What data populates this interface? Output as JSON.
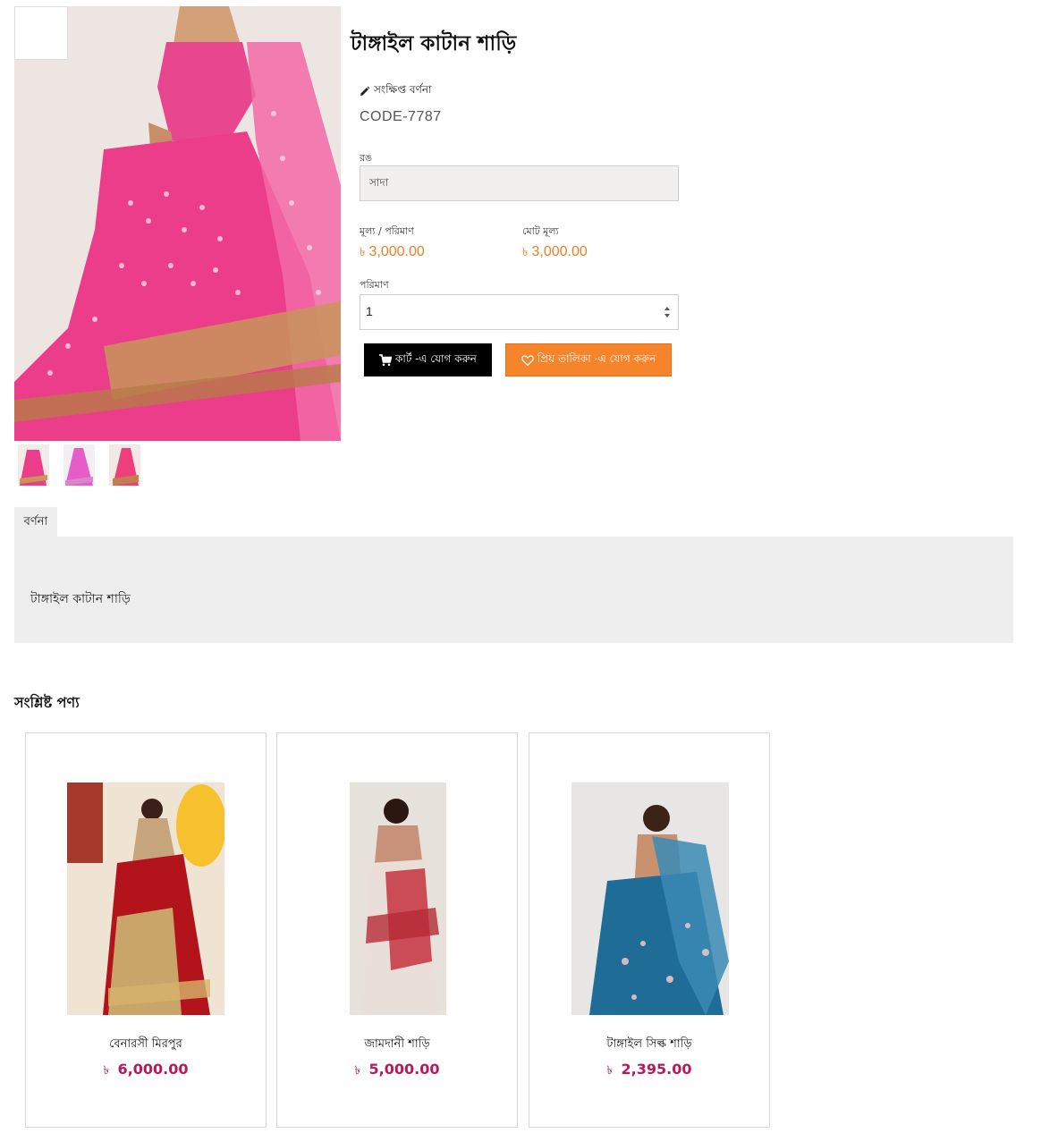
{
  "product": {
    "title": "টাঙ্গাইল কাটান শাড়ি",
    "short_description_label": "সংক্ষিপ্ত বর্ণনা",
    "code": "CODE-7787",
    "color_label": "রঙ",
    "color_value": "সাদা",
    "unit_price_label": "মূল্য / পরিমাণ",
    "total_price_label": "মোট মূল্য",
    "currency_symbol": "৳",
    "unit_price": "3,000.00",
    "total_price": "3,000.00",
    "quantity_label": "পরিমাণ",
    "quantity_value": "1",
    "add_to_cart_label": "কার্ট -এ যোগ করুন",
    "add_to_wishlist_label": "প্রিয় তালিকা -এ যোগ করুন",
    "thumbnail_count": 3
  },
  "description_tab": {
    "tab_label": "বর্ণনা",
    "content": "টাঙ্গাইল কাটান শাড়ি"
  },
  "related": {
    "title": "সংশ্লিষ্ট পণ্য",
    "items": [
      {
        "name": "বেনারসী মিরপুর",
        "currency": "৳",
        "price": "6,000.00"
      },
      {
        "name": "জামদানী শাড়ি",
        "currency": "৳",
        "price": "5,000.00"
      },
      {
        "name": "টাঙ্গাইল সিল্ক শাড়ি",
        "currency": "৳",
        "price": "2,395.00"
      }
    ]
  },
  "colors": {
    "price_orange": "#ee7e25",
    "related_price": "#b51a5b",
    "wishlist_button": "#f6842a",
    "cart_button": "#000000",
    "saree_pink": "#ec3d8a"
  },
  "icons": {
    "short_desc": "pencil-icon",
    "cart": "shopping-cart-icon",
    "wishlist": "heart-icon",
    "spinner": "spinner-arrows-icon"
  }
}
